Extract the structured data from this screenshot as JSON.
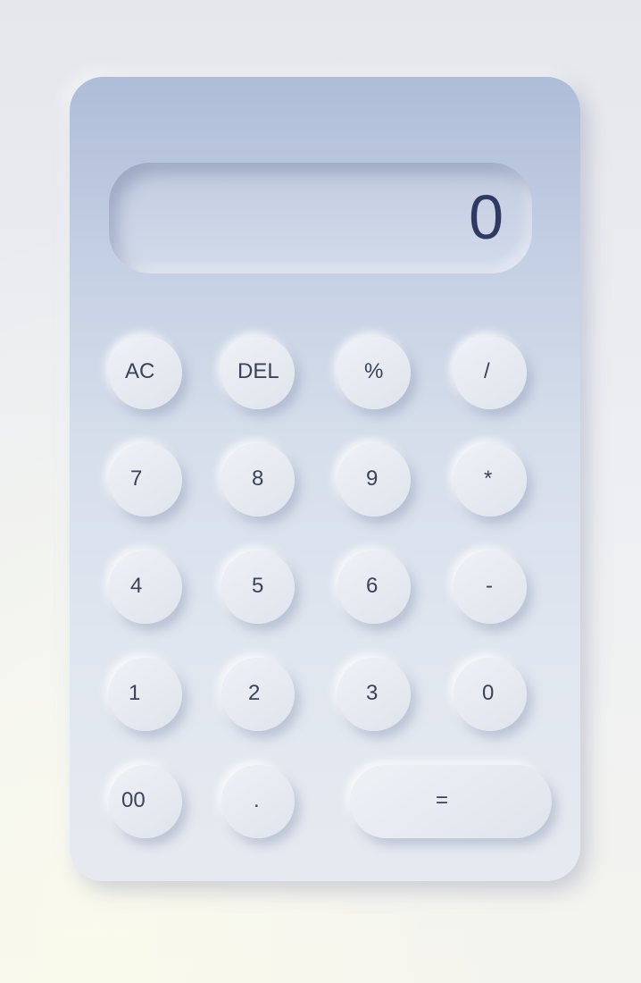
{
  "display": {
    "value": "0"
  },
  "keys": {
    "ac": "AC",
    "del": "DEL",
    "percent": "%",
    "divide": "/",
    "seven": "7",
    "eight": "8",
    "nine": "9",
    "multiply": "*",
    "four": "4",
    "five": "5",
    "six": "6",
    "subtract": "-",
    "one": "1",
    "two": "2",
    "three": "3",
    "zero": "0",
    "double_zero": "00",
    "decimal": ".",
    "equals": "="
  }
}
